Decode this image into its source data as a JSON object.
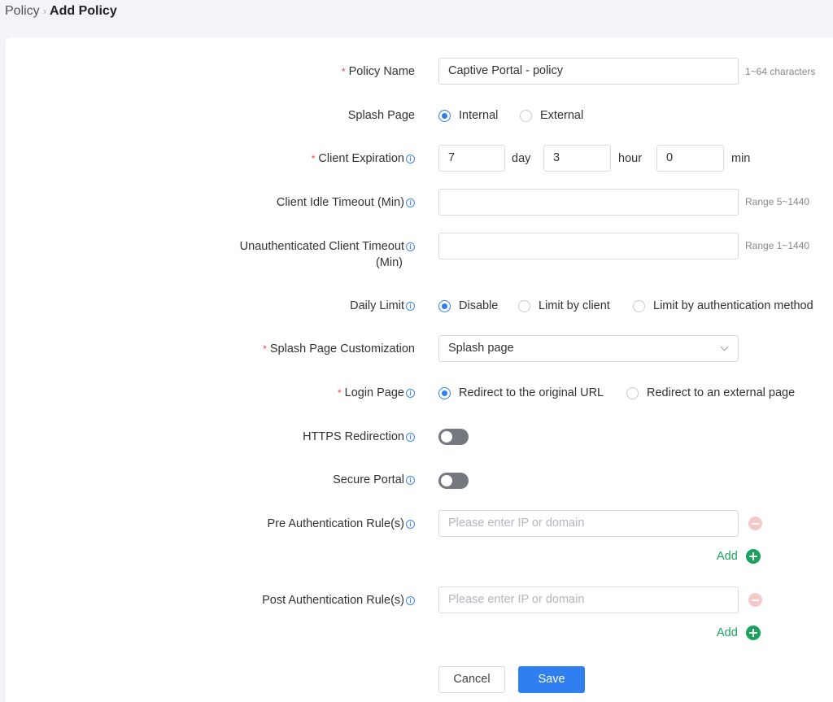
{
  "breadcrumb": {
    "parent": "Policy",
    "separator": "›",
    "current": "Add Policy"
  },
  "required_mark": "*",
  "info_glyph": "i",
  "form": {
    "policy_name": {
      "label": "Policy Name",
      "value": "Captive Portal - policy",
      "hint": "1~64 characters"
    },
    "splash_page": {
      "label": "Splash Page",
      "options": [
        "Internal",
        "External"
      ],
      "selected": "Internal"
    },
    "client_expiration": {
      "label": "Client Expiration",
      "day_value": "7",
      "day_unit": "day",
      "hour_value": "3",
      "hour_unit": "hour",
      "min_value": "0",
      "min_unit": "min"
    },
    "client_idle_timeout": {
      "label": "Client Idle Timeout (Min)",
      "value": "",
      "hint": "Range 5~1440"
    },
    "unauth_timeout": {
      "label_line1": "Unauthenticated Client Timeout",
      "label_line2": "(Min)",
      "value": "",
      "hint": "Range 1~1440"
    },
    "daily_limit": {
      "label": "Daily Limit",
      "options": [
        "Disable",
        "Limit by client",
        "Limit by authentication method"
      ],
      "selected": "Disable"
    },
    "splash_customization": {
      "label": "Splash Page Customization",
      "value": "Splash page"
    },
    "login_page": {
      "label": "Login Page",
      "options": [
        "Redirect to the original URL",
        "Redirect to an external page"
      ],
      "selected": "Redirect to the original URL"
    },
    "https_redirection": {
      "label": "HTTPS Redirection",
      "enabled": false
    },
    "secure_portal": {
      "label": "Secure Portal",
      "enabled": false
    },
    "pre_auth": {
      "label": "Pre Authentication Rule(s)",
      "placeholder": "Please enter IP or domain",
      "add_label": "Add"
    },
    "post_auth": {
      "label": "Post Authentication Rule(s)",
      "placeholder": "Please enter IP or domain",
      "add_label": "Add"
    }
  },
  "actions": {
    "cancel": "Cancel",
    "save": "Save"
  },
  "colors": {
    "accent": "#2f7ff0",
    "add_green": "#1aa35c",
    "required_red": "#e5484d",
    "toggle_off": "#75787f"
  }
}
